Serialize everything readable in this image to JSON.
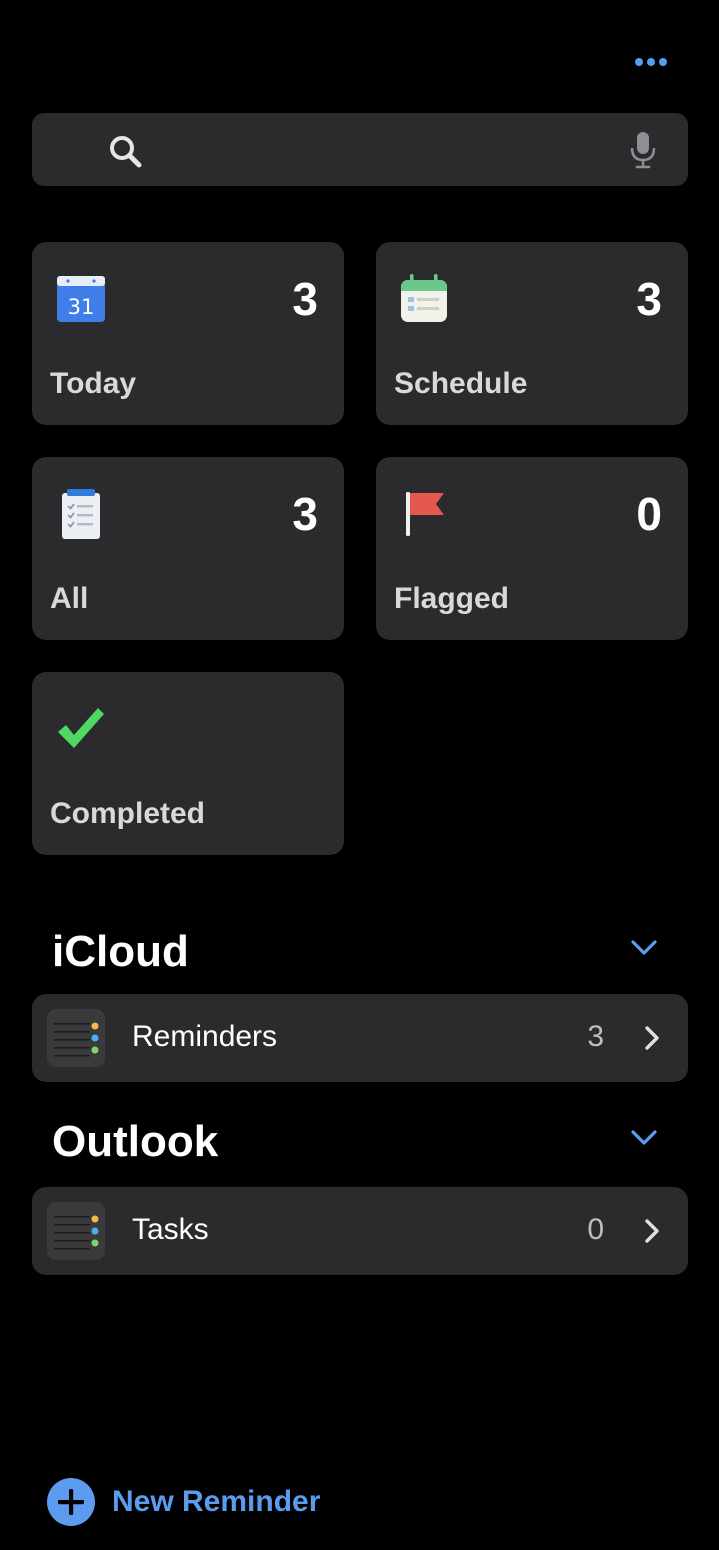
{
  "header": {
    "more_icon": "more-horizontal-icon"
  },
  "search": {
    "placeholder": "",
    "value": "",
    "left_icon": "search-icon",
    "right_icon": "microphone-icon"
  },
  "smart_lists": [
    {
      "label": "Today",
      "count": "3",
      "icon": "calendar-icon",
      "icon_text": "31"
    },
    {
      "label": "Schedule",
      "count": "3",
      "icon": "schedule-icon"
    },
    {
      "label": "All",
      "count": "3",
      "icon": "clipboard-icon"
    },
    {
      "label": "Flagged",
      "count": "0",
      "icon": "flag-icon"
    },
    {
      "label": "Completed",
      "icon": "checkmark-icon"
    }
  ],
  "accounts": [
    {
      "title": "iCloud",
      "expanded": true,
      "lists": [
        {
          "name": "Reminders",
          "count": "3",
          "icon": "list-icon"
        }
      ]
    },
    {
      "title": "Outlook",
      "expanded": true,
      "lists": [
        {
          "name": "Tasks",
          "count": "0",
          "icon": "list-icon"
        }
      ]
    }
  ],
  "footer": {
    "new_reminder_label": "New Reminder",
    "icon": "plus-circle-icon"
  },
  "colors": {
    "background": "#000000",
    "card": "#2b2b2d",
    "accent": "#5b9cf0",
    "check_green": "#4cd964",
    "flag_red": "#e5574f"
  }
}
